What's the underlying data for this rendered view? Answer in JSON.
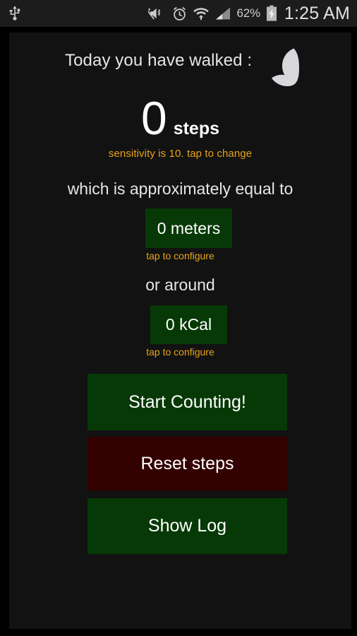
{
  "statusbar": {
    "icons_left": [
      "usb-icon"
    ],
    "icons_right": [
      "mute-vibrate-icon",
      "alarm-icon",
      "wifi-icon",
      "cellular-signal-icon"
    ],
    "battery_percent": "62%",
    "battery_state": "charging-battery-icon",
    "clock": "1:25 AM"
  },
  "app": {
    "header": {
      "title": "Today you have walked :",
      "icon": "crescent-moon-icon"
    },
    "steps": {
      "count": "0",
      "unit": "steps",
      "sensitivity_note": "sensitivity is 10. tap to change"
    },
    "distance": {
      "label": "which is approximately equal to",
      "value": "0 meters",
      "hint": "tap to configure"
    },
    "calories": {
      "label": "or around",
      "value": "0 kCal",
      "hint": "tap to configure"
    },
    "actions": {
      "start": "Start Counting!",
      "reset": "Reset steps",
      "log": "Show Log"
    },
    "colors": {
      "background": "#121212",
      "green_button": "#063906",
      "red_button": "#330200",
      "accent_orange": "#e8a317",
      "text_primary": "#e6e6e6"
    }
  }
}
